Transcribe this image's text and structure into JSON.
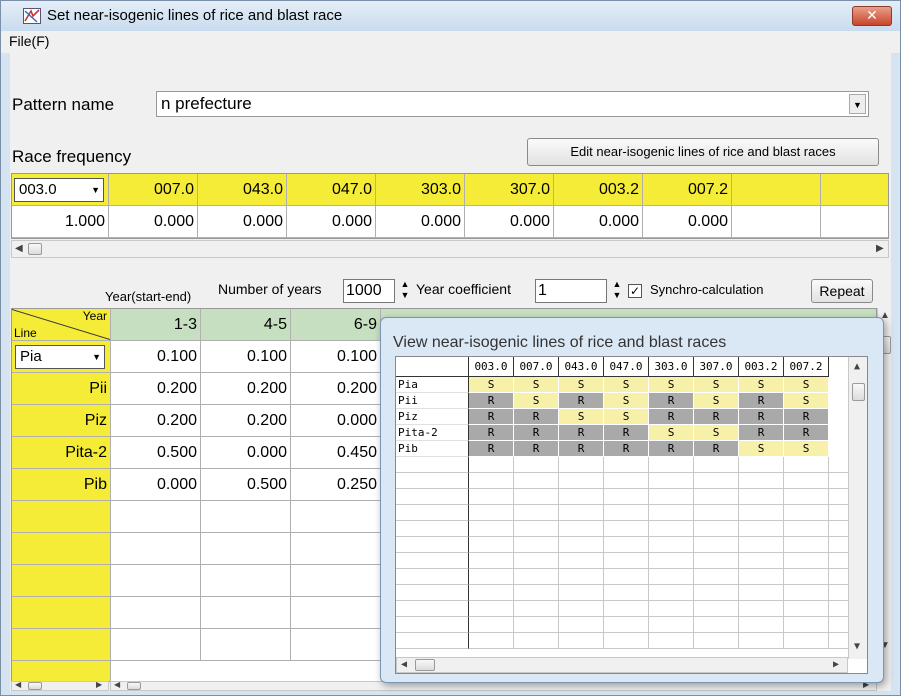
{
  "window": {
    "title": "Set near-isogenic lines of rice and blast race",
    "close_glyph": "✕",
    "menu": {
      "file": "File(F)"
    }
  },
  "pattern": {
    "label": "Pattern name",
    "value": "n prefecture"
  },
  "race_frequency": {
    "label": "Race frequency",
    "edit_button": "Edit near-isogenic lines of rice and blast races",
    "selected_race": "003.0",
    "races": [
      "007.0",
      "043.0",
      "047.0",
      "303.0",
      "307.0",
      "003.2",
      "007.2"
    ],
    "values": [
      "1.000",
      "0.000",
      "0.000",
      "0.000",
      "0.000",
      "0.000",
      "0.000",
      "0.000"
    ]
  },
  "controls": {
    "year_range_label": "Year(start-end)",
    "num_years_label": "Number of years",
    "num_years_value": "1000",
    "year_coef_label": "Year coefficient",
    "year_coef_value": "1",
    "synchro_label": "Synchro-calculation",
    "synchro_checked": "✓",
    "repeat_button": "Repeat"
  },
  "year_table": {
    "corner_year": "Year",
    "corner_line": "Line",
    "selected_line": "Pia",
    "columns": [
      "1-3",
      "4-5",
      "6-9"
    ],
    "rows": [
      {
        "line": "Pia",
        "values": [
          "0.100",
          "0.100",
          "0.100"
        ]
      },
      {
        "line": "Pii",
        "values": [
          "0.200",
          "0.200",
          "0.200"
        ]
      },
      {
        "line": "Piz",
        "values": [
          "0.200",
          "0.200",
          "0.000"
        ]
      },
      {
        "line": "Pita-2",
        "values": [
          "0.500",
          "0.000",
          "0.450"
        ]
      },
      {
        "line": "Pib",
        "values": [
          "0.000",
          "0.500",
          "0.250"
        ]
      }
    ]
  },
  "popup": {
    "title": "View near-isogenic lines of rice and blast races",
    "races": [
      "003.0",
      "007.0",
      "043.0",
      "047.0",
      "303.0",
      "307.0",
      "003.2",
      "007.2"
    ],
    "lines": [
      "Pia",
      "Pii",
      "Piz",
      "Pita-2",
      "Pib"
    ],
    "matrix": [
      [
        "S",
        "S",
        "S",
        "S",
        "S",
        "S",
        "S",
        "S"
      ],
      [
        "R",
        "S",
        "R",
        "S",
        "R",
        "S",
        "R",
        "S"
      ],
      [
        "R",
        "R",
        "S",
        "S",
        "R",
        "R",
        "R",
        "R"
      ],
      [
        "R",
        "R",
        "R",
        "R",
        "S",
        "S",
        "R",
        "R"
      ],
      [
        "R",
        "R",
        "R",
        "R",
        "R",
        "R",
        "S",
        "S"
      ]
    ],
    "colors": {
      "S": "#f7f0a8",
      "R": "#a9a9a9"
    }
  },
  "icons": {
    "dropdown": "▼",
    "left": "◀",
    "right": "▶",
    "up": "▲",
    "down": "▼"
  }
}
